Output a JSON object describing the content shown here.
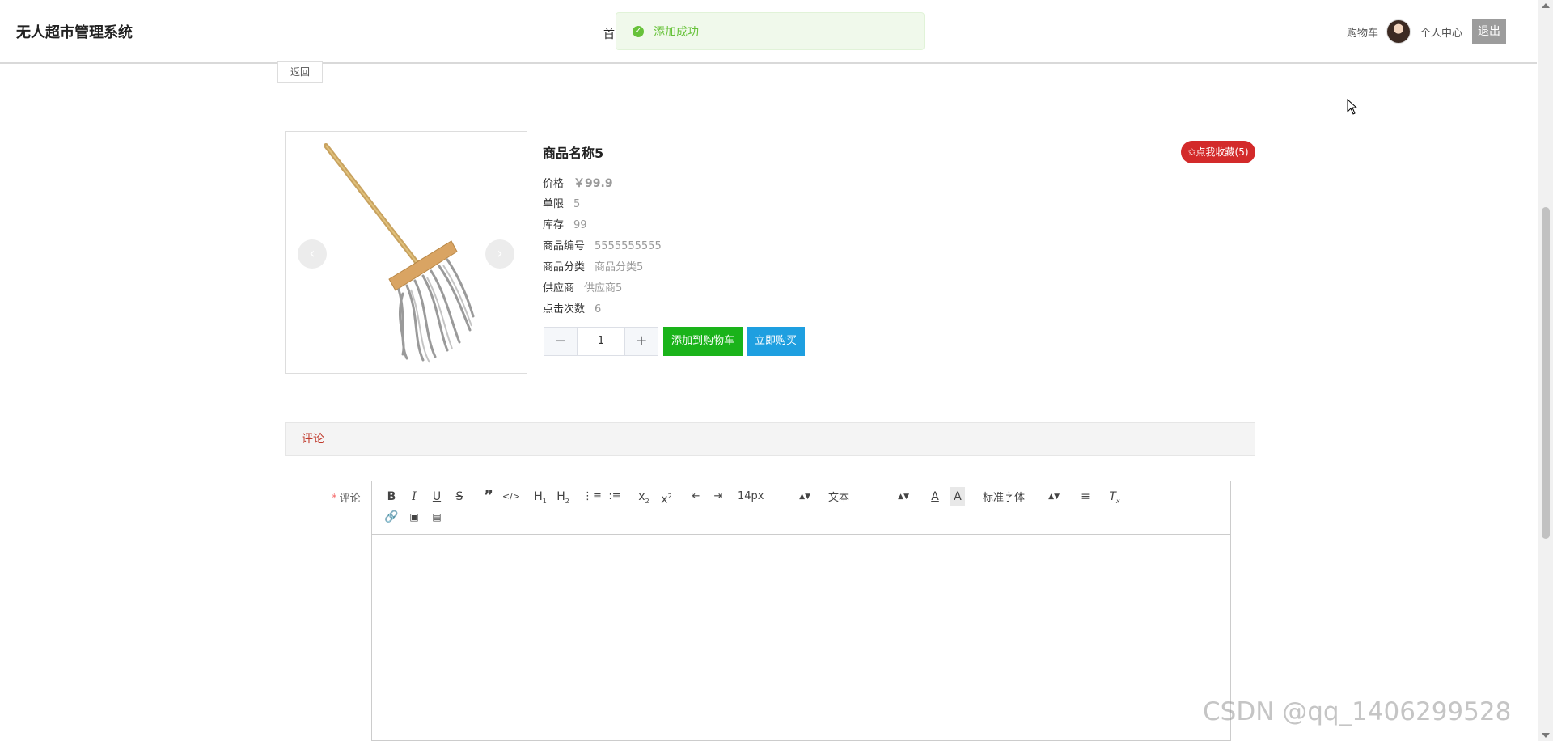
{
  "header": {
    "brand": "无人超市管理系统",
    "nav_first": "首",
    "cart_link": "购物车",
    "profile_link": "个人中心",
    "logout": "退出"
  },
  "toast": {
    "text": "添加成功",
    "icon": "check-circle-icon"
  },
  "back_button": "返回",
  "product": {
    "name": "商品名称5",
    "favorite_button": "✩点我收藏(5)",
    "fields": [
      {
        "label": "价格",
        "value": "￥99.9"
      },
      {
        "label": "单限",
        "value": "5"
      },
      {
        "label": "库存",
        "value": "99"
      },
      {
        "label": "商品编号",
        "value": "5555555555"
      },
      {
        "label": "商品分类",
        "value": "商品分类5"
      },
      {
        "label": "供应商",
        "value": "供应商5"
      },
      {
        "label": "点击次数",
        "value": "6"
      }
    ],
    "quantity": "1",
    "add_to_cart": "添加到购物车",
    "buy_now": "立即购买",
    "colors": {
      "cart_button": "#1ab31a",
      "buy_button": "#1e9fe0",
      "favorite": "#d32a2a"
    }
  },
  "comment": {
    "tab_label": "评论",
    "form_label": "评论",
    "required_mark": "*",
    "toolbar": {
      "font_size": "14px",
      "block_type": "文本",
      "font_family": "标准字体"
    }
  },
  "watermark": "CSDN @qq_1406299528"
}
